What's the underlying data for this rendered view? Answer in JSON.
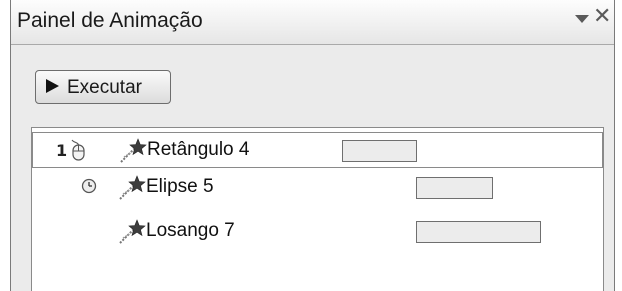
{
  "panel": {
    "title": "Painel de Animação"
  },
  "toolbar": {
    "run_label": "Executar"
  },
  "animations": [
    {
      "order": "1",
      "trigger": "on-click",
      "effect_icon": "entrance-star-icon",
      "label": "Retângulo 4"
    },
    {
      "order": "",
      "trigger": "after-previous",
      "effect_icon": "entrance-star-icon",
      "label": "Elipse 5"
    },
    {
      "order": "",
      "trigger": "with-previous",
      "effect_icon": "entrance-star-icon",
      "label": "Losango 7"
    }
  ]
}
